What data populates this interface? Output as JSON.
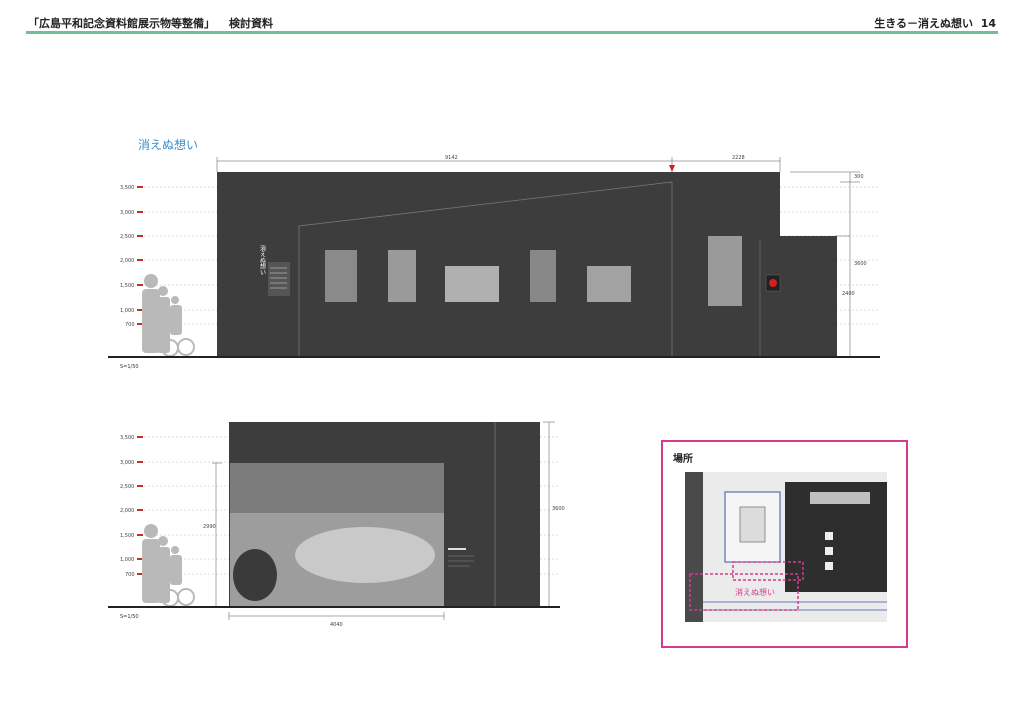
{
  "header": {
    "title": "「広島平和記念資料館展示物等整備」",
    "subtitle": "検討資料",
    "right": "生きる－消えぬ想い",
    "page_number": "14"
  },
  "section_title": "消えぬ想い",
  "elevation_top": {
    "scale": "S=1/50",
    "levels": [
      "3,500",
      "3,000",
      "2,500",
      "2,000",
      "1,500",
      "1,000",
      "700"
    ],
    "dimensions": [
      "9142",
      "2228",
      "300",
      "3600",
      "2400"
    ],
    "panel_text": "消えぬ想い"
  },
  "elevation_bottom": {
    "scale": "S=1/50",
    "levels": [
      "3,500",
      "3,000",
      "2,500",
      "2,000",
      "1,500",
      "1,000",
      "700"
    ],
    "dimensions": [
      "2990",
      "3600",
      "4040"
    ]
  },
  "location": {
    "title": "場所",
    "label": "消えぬ想い"
  },
  "colors": {
    "wall": "#3d3d3d",
    "header_line": "#6fc098",
    "location_border": "#d63a8f",
    "section_title": "#3a8ec8"
  }
}
